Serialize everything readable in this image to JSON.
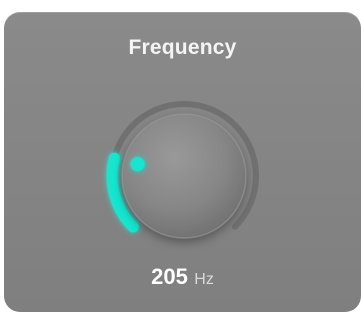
{
  "control": {
    "title": "Frequency",
    "value": "205",
    "unit": "Hz",
    "level_fraction": 0.22,
    "accent_color": "#19e6cf"
  }
}
